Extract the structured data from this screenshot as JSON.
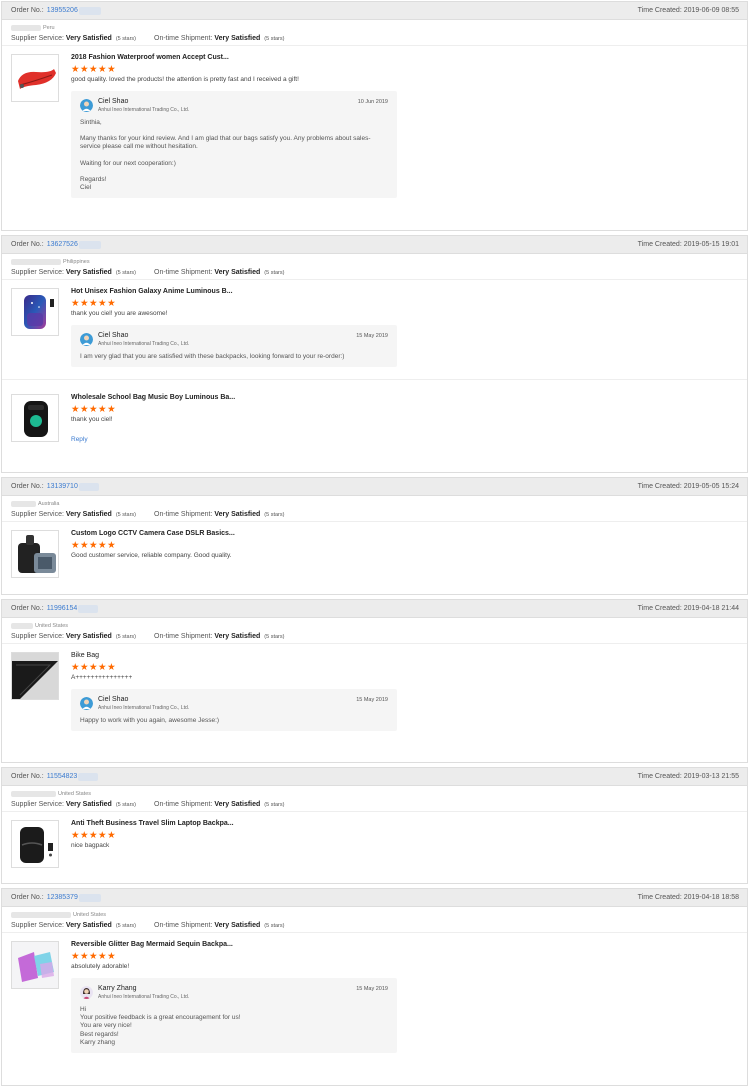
{
  "labels": {
    "order_no": "Order No.:",
    "time_created": "Time Created:",
    "supplier_service": "Supplier Service:",
    "ontime_shipment": "On-time Shipment:",
    "stars_text": "(5 stars)",
    "rating_stars": "★★★★★",
    "reply_link": "Reply"
  },
  "colors": {
    "accent": "#3b7bd0",
    "stars": "#ff6a00",
    "header_bg": "#ececec"
  },
  "orders": [
    {
      "order_no": "13955206",
      "time": "2019-06-09 08:55",
      "country": "Peru",
      "supplier_service": "Very Satisfied",
      "shipment": "Very Satisfied",
      "products": [
        {
          "title": "2018 Fashion Waterproof women Accept Cust...",
          "icon": "waist-bag-image",
          "comment": "good quality. loved the products! the attention is pretty fast and I received a gift!",
          "reply": {
            "name": "Ciel Shao",
            "company": "Anhui Ineo International Trading Co., Ltd.",
            "date": "10 Jun 2019",
            "lines": [
              "Sinthia,",
              "",
              "Many thanks for your kind review. And I am glad that our bags satisfy you. Any problems about sales-",
              "service please call me without hesitation.",
              "",
              "Waiting for our next cooperation:)",
              "",
              "Regards!",
              "Ciel"
            ]
          }
        }
      ]
    },
    {
      "order_no": "13627526",
      "time": "2019-05-15 19:01",
      "country": "Philippines",
      "supplier_service": "Very Satisfied",
      "shipment": "Very Satisfied",
      "products": [
        {
          "title": "Hot Unisex Fashion Galaxy Anime Luminous B...",
          "icon": "galaxy-backpack-image",
          "comment": "thank you ciel! you are awesome!",
          "reply": {
            "name": "Ciel Shao",
            "company": "Anhui Ineo International Trading Co., Ltd.",
            "date": "15 May 2019",
            "lines": [
              "I am very glad that you are satisfied with these backpacks, looking forward to your re-order:)"
            ]
          }
        },
        {
          "title": "Wholesale School Bag Music Boy Luminous Ba...",
          "icon": "luminous-backpack-image",
          "comment": "thank you ciel!",
          "show_reply_link": true
        }
      ]
    },
    {
      "order_no": "13139710",
      "time": "2019-05-05 15:24",
      "country": "Australia",
      "supplier_service": "Very Satisfied",
      "shipment": "Very Satisfied",
      "products": [
        {
          "title": "Custom Logo CCTV Camera Case DSLR Basics...",
          "icon": "camera-backpack-image",
          "comment": "Good customer service, reliable company. Good quality."
        }
      ]
    },
    {
      "order_no": "11996154",
      "time": "2019-04-18 21:44",
      "country": "United States",
      "supplier_service": "Very Satisfied",
      "shipment": "Very Satisfied",
      "products": [
        {
          "title": "Bike Bag",
          "icon": "bike-bag-image",
          "normal_title": true,
          "comment": "A+++++++++++++++",
          "reply": {
            "name": "Ciel Shao",
            "company": "Anhui Ineo International Trading Co., Ltd.",
            "date": "15 May 2019",
            "lines": [
              "Happy to work with you again, awesome Jesse:)"
            ]
          }
        }
      ]
    },
    {
      "order_no": "11554823",
      "time": "2019-03-13 21:55",
      "country": "United States",
      "supplier_service": "Very Satisfied",
      "shipment": "Very Satisfied",
      "products": [
        {
          "title": "Anti Theft Business Travel Slim Laptop Backpa...",
          "icon": "laptop-backpack-image",
          "comment": "nice bagpack"
        }
      ]
    },
    {
      "order_no": "12385379",
      "time": "2019-04-18 18:58",
      "country": "United States",
      "supplier_service": "Very Satisfied",
      "shipment": "Very Satisfied",
      "products": [
        {
          "title": "Reversible Glitter Bag Mermaid Sequin Backpa...",
          "icon": "sequin-bag-image",
          "comment": "absolutely adorable!",
          "reply": {
            "name": "Karry Zhang",
            "company": "Anhui Ineo International Trading Co., Ltd.",
            "date": "15 May 2019",
            "avatar": "female",
            "lines": [
              "Hi",
              "Your positive feedback is a great encouragement for us!",
              "You are very nice!",
              "Best regards!",
              "Karry zhang"
            ]
          }
        }
      ]
    }
  ]
}
